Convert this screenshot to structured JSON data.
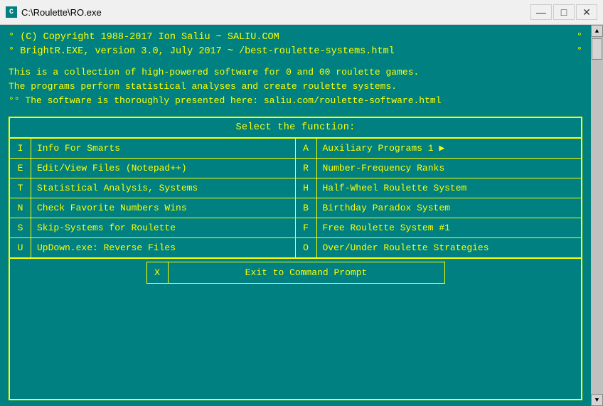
{
  "window": {
    "title": "C:\\Roulette\\RO.exe",
    "icon_label": "C",
    "controls": {
      "minimize": "—",
      "maximize": "□",
      "close": "✕"
    }
  },
  "header": {
    "line1_left": "° (C) Copyright 1988-2017 Ion Saliu ~ SALIU.COM",
    "line1_right": "°",
    "line2_left": "° BrightR.EXE, version 3.0, July 2017 ~ /best-roulette-systems.html",
    "line2_right": "°"
  },
  "description": [
    "This is a collection of high-powered software for 0 and 00 roulette games.",
    "The programs perform statistical analyses and create roulette systems.",
    "°° The software is thoroughly presented here: saliu.com/roulette-software.html"
  ],
  "menu": {
    "title": "Select the function:",
    "items_left": [
      {
        "key": "I",
        "label": "Info For Smarts"
      },
      {
        "key": "E",
        "label": "Edit/View Files (Notepad++)"
      },
      {
        "key": "T",
        "label": "Statistical Analysis, Systems"
      },
      {
        "key": "N",
        "label": "Check Favorite Numbers Wins"
      },
      {
        "key": "S",
        "label": "Skip-Systems for Roulette"
      },
      {
        "key": "U",
        "label": "UpDown.exe: Reverse Files"
      }
    ],
    "items_right": [
      {
        "key": "A",
        "label": "Auxiliary Programs 1 ▶"
      },
      {
        "key": "R",
        "label": "Number-Frequency Ranks"
      },
      {
        "key": "H",
        "label": "Half-Wheel Roulette System"
      },
      {
        "key": "B",
        "label": "Birthday Paradox System"
      },
      {
        "key": "F",
        "label": "Free Roulette System #1"
      },
      {
        "key": "O",
        "label": "Over/Under Roulette Strategies"
      }
    ],
    "exit": {
      "key": "X",
      "label": "Exit to Command Prompt"
    }
  },
  "colors": {
    "bg": "#008080",
    "text": "#ffff00",
    "border": "#ffff00"
  }
}
